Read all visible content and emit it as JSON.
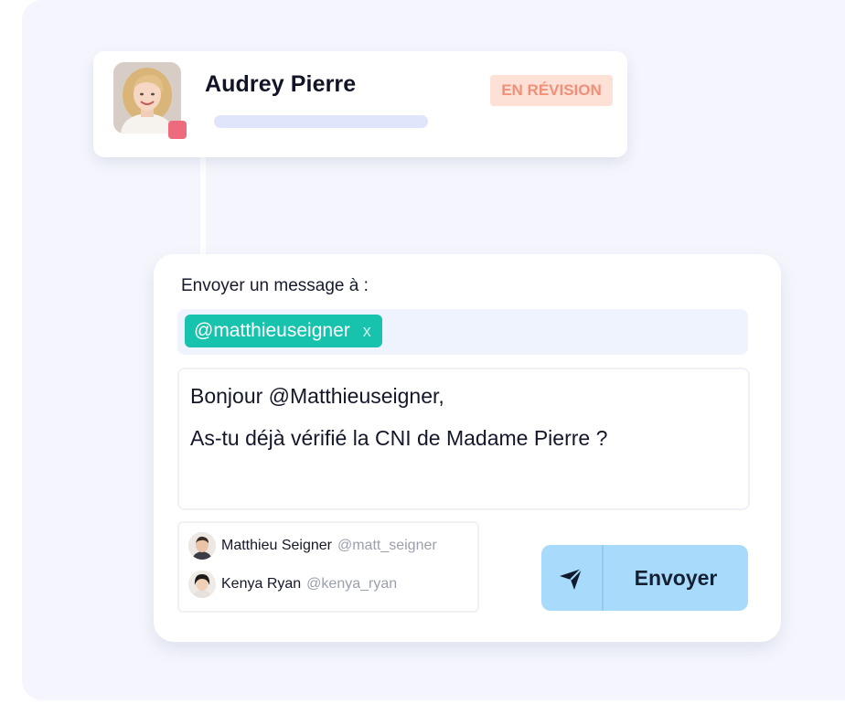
{
  "profile": {
    "name": "Audrey Pierre",
    "status": "EN RÉVISION",
    "status_colors": {
      "background": "#fde0d6",
      "text": "#f28f78"
    },
    "presence_color": "#ee6b7d"
  },
  "message_form": {
    "send_to_label": "Envoyer un message à :",
    "recipient": {
      "handle": "@matthieuseigner",
      "remove_label": "x",
      "chip_color": "#17c3ac"
    },
    "message_lines": [
      "Bonjour @Matthieuseigner,",
      "As-tu déjà vérifié la CNI de Madame Pierre ?"
    ],
    "suggestions": [
      {
        "name": "Matthieu Seigner",
        "handle": "@matt_seigner"
      },
      {
        "name": "Kenya Ryan",
        "handle": "@kenya_ryan"
      }
    ],
    "send_button": {
      "label": "Envoyer",
      "icon": "paper-plane-icon",
      "color": "#a8dbfb"
    }
  }
}
